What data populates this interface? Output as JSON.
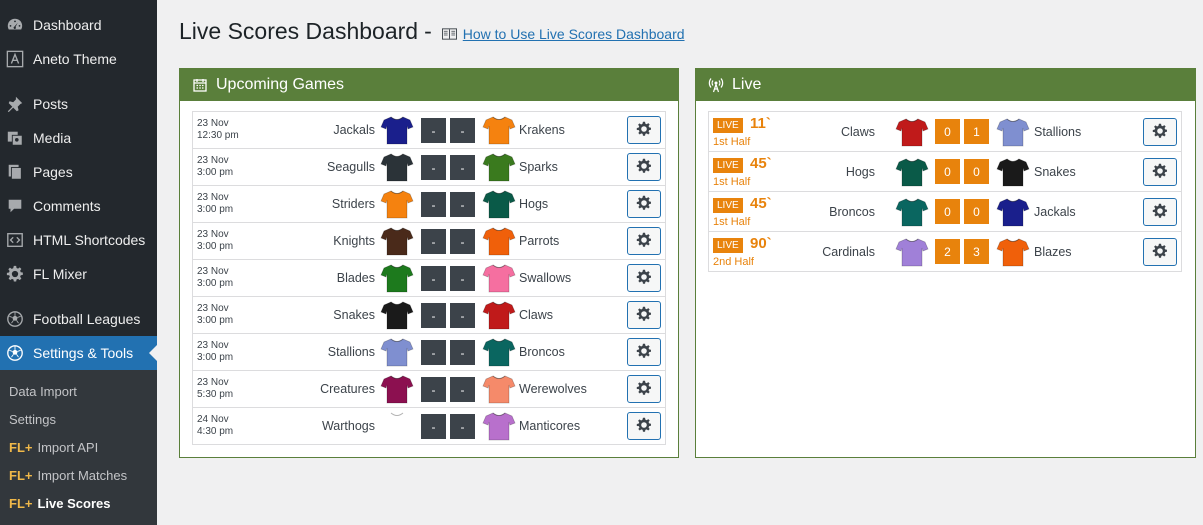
{
  "sidebar": {
    "items": [
      {
        "label": "Dashboard",
        "icon": "dashboard-icon"
      },
      {
        "label": "Aneto Theme",
        "icon": "theme-icon"
      },
      {
        "label": "Posts",
        "icon": "pin-icon"
      },
      {
        "label": "Media",
        "icon": "media-icon"
      },
      {
        "label": "Pages",
        "icon": "pages-icon"
      },
      {
        "label": "Comments",
        "icon": "comment-icon"
      },
      {
        "label": "HTML Shortcodes",
        "icon": "code-icon"
      },
      {
        "label": "FL Mixer",
        "icon": "gear-icon"
      },
      {
        "label": "Football Leagues",
        "icon": "football-icon"
      },
      {
        "label": "Settings & Tools",
        "icon": "football-icon"
      }
    ],
    "submenu": [
      {
        "prefix": "",
        "label": "Data Import"
      },
      {
        "prefix": "",
        "label": "Settings"
      },
      {
        "prefix": "FL+",
        "label": "Import API"
      },
      {
        "prefix": "FL+",
        "label": "Import Matches"
      },
      {
        "prefix": "FL+",
        "label": "Live Scores"
      }
    ]
  },
  "header": {
    "title": "Live Scores Dashboard",
    "separator": "-",
    "help_link": "How to Use Live Scores Dashboard"
  },
  "upcoming": {
    "title": "Upcoming Games",
    "games": [
      {
        "date": "23 Nov",
        "time": "12:30 pm",
        "home": "Jackals",
        "home_color": "#1a1f8c",
        "away": "Krakens",
        "away_color": "#f5820f",
        "home_score": "-",
        "away_score": "-"
      },
      {
        "date": "23 Nov",
        "time": "3:00 pm",
        "home": "Seagulls",
        "home_color": "#2b3338",
        "away": "Sparks",
        "away_color": "#3a7a1e",
        "home_score": "-",
        "away_score": "-"
      },
      {
        "date": "23 Nov",
        "time": "3:00 pm",
        "home": "Striders",
        "home_color": "#f5820f",
        "away": "Hogs",
        "away_color": "#0a5a48",
        "home_score": "-",
        "away_score": "-"
      },
      {
        "date": "23 Nov",
        "time": "3:00 pm",
        "home": "Knights",
        "home_color": "#4a2a1a",
        "away": "Parrots",
        "away_color": "#f0600a",
        "home_score": "-",
        "away_score": "-"
      },
      {
        "date": "23 Nov",
        "time": "3:00 pm",
        "home": "Blades",
        "home_color": "#1d7a1d",
        "away": "Swallows",
        "away_color": "#f56fa0",
        "home_score": "-",
        "away_score": "-"
      },
      {
        "date": "23 Nov",
        "time": "3:00 pm",
        "home": "Snakes",
        "home_color": "#1a1a1a",
        "away": "Claws",
        "away_color": "#c01a1a",
        "home_score": "-",
        "away_score": "-"
      },
      {
        "date": "23 Nov",
        "time": "3:00 pm",
        "home": "Stallions",
        "home_color": "#7f8fd0",
        "away": "Broncos",
        "away_color": "#0a6660",
        "home_score": "-",
        "away_score": "-"
      },
      {
        "date": "23 Nov",
        "time": "5:30 pm",
        "home": "Creatures",
        "home_color": "#8c1050",
        "away": "Werewolves",
        "away_color": "#f58a6a",
        "home_score": "-",
        "away_score": "-"
      },
      {
        "date": "24 Nov",
        "time": "4:30 pm",
        "home": "Warthogs",
        "home_color": "#ffffff",
        "away": "Manticores",
        "away_color": "#b870cc",
        "home_score": "-",
        "away_score": "-"
      }
    ]
  },
  "live": {
    "title": "Live",
    "badge": "LIVE",
    "games": [
      {
        "minute": "11`",
        "half": "1st Half",
        "home": "Claws",
        "home_color": "#c01a1a",
        "away": "Stallions",
        "away_color": "#7f8fd0",
        "home_score": "0",
        "away_score": "1"
      },
      {
        "minute": "45`",
        "half": "1st Half",
        "home": "Hogs",
        "home_color": "#0a5a48",
        "away": "Snakes",
        "away_color": "#1a1a1a",
        "home_score": "0",
        "away_score": "0"
      },
      {
        "minute": "45`",
        "half": "1st Half",
        "home": "Broncos",
        "home_color": "#0a6660",
        "away": "Jackals",
        "away_color": "#1a1f8c",
        "home_score": "0",
        "away_score": "0"
      },
      {
        "minute": "90`",
        "half": "2nd Half",
        "home": "Cardinals",
        "home_color": "#a080d8",
        "away": "Blazes",
        "away_color": "#f0600a",
        "home_score": "2",
        "away_score": "3"
      }
    ]
  },
  "colors": {
    "panel_header": "#5a7f3b",
    "live_accent": "#e8830c",
    "sidebar_bg": "#23282d",
    "sidebar_active": "#2271b1",
    "score_box": "#3c434a"
  }
}
